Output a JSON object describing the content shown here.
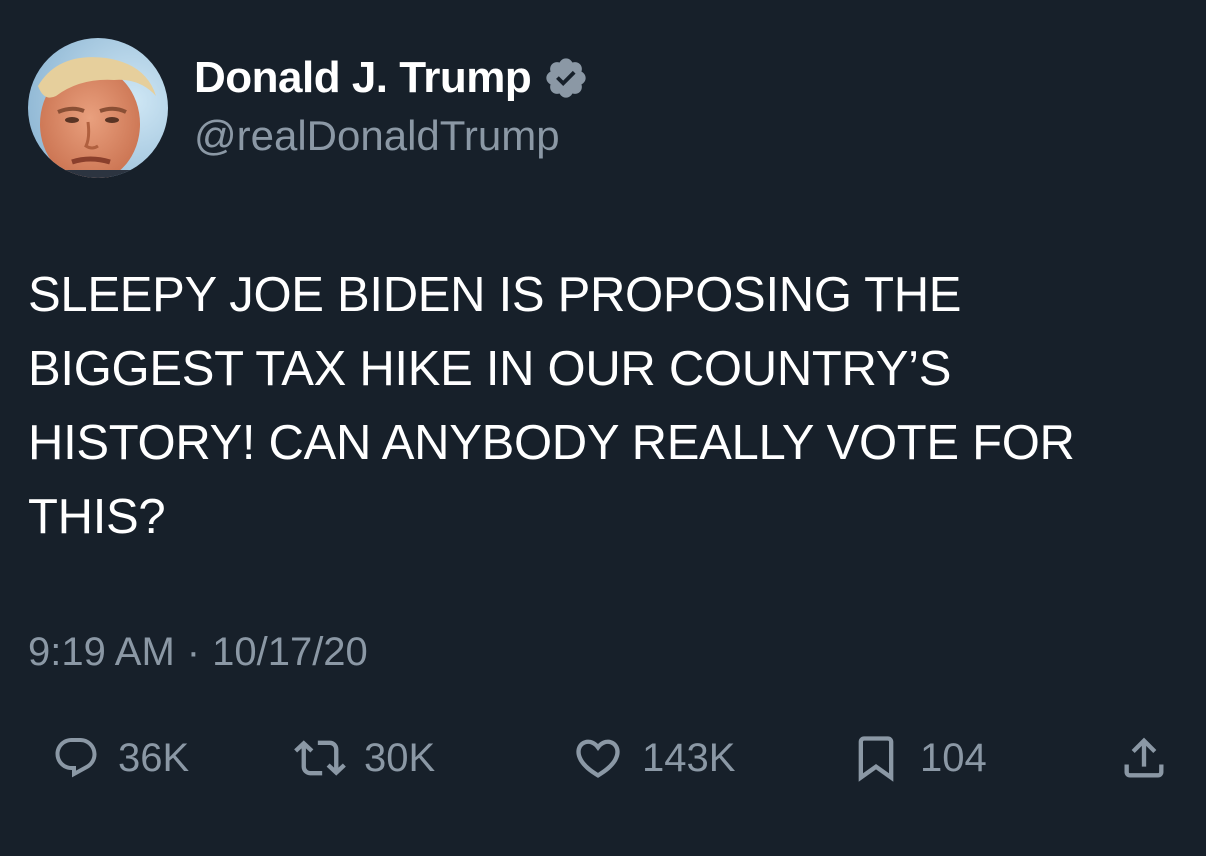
{
  "user": {
    "display_name": "Donald J. Trump",
    "handle": "@realDonaldTrump",
    "verified": true
  },
  "tweet": {
    "text": "SLEEPY JOE BIDEN IS PROPOSING THE\nBIGGEST TAX HIKE IN OUR COUNTRY’S\nHISTORY! CAN ANYBODY REALLY VOTE FOR\nTHIS?",
    "time": "9:19 AM",
    "separator": "·",
    "date": "10/17/20"
  },
  "actions": {
    "reply": {
      "icon": "reply-icon",
      "count": "36K"
    },
    "retweet": {
      "icon": "retweet-icon",
      "count": "30K"
    },
    "like": {
      "icon": "heart-icon",
      "count": "143K"
    },
    "bookmark": {
      "icon": "bookmark-icon",
      "count": "104"
    },
    "share": {
      "icon": "share-icon"
    }
  },
  "colors": {
    "background": "#17202a",
    "primary_text": "#ffffff",
    "secondary_text": "#8b98a5",
    "verified_badge": "#8b98a5"
  }
}
